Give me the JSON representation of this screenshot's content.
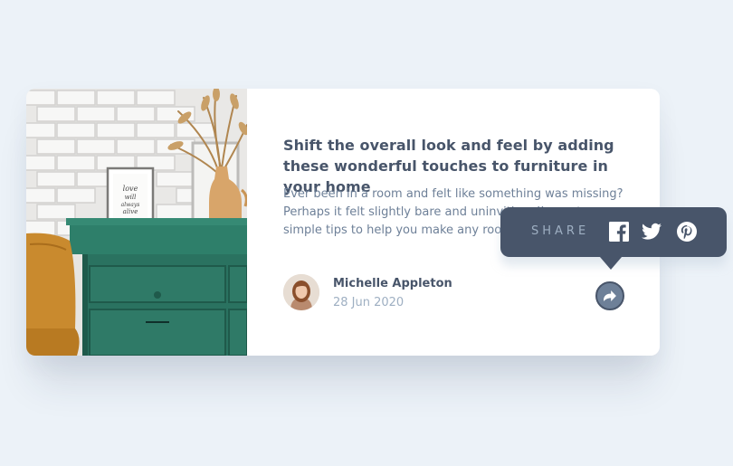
{
  "article": {
    "title": "Shift the overall look and feel by adding these wonderful touches to furniture in your home",
    "description": "Ever been in a room and felt like something was missing? Perhaps it felt slightly bare and uninviting. I’ve got some simple tips to help you make any room feel complete."
  },
  "author": {
    "name": "Michelle Appleton",
    "date": "28 Jun 2020"
  },
  "share": {
    "label": "SHARE",
    "networks": [
      "facebook-icon",
      "twitter-icon",
      "pinterest-icon"
    ],
    "button_icon": "share-arrow-icon"
  },
  "photo": {
    "frame_text": "love will always alive"
  },
  "colors": {
    "page_bg": "#ecf2f8",
    "card_bg": "#ffffff",
    "heading": "#48556a",
    "body": "#6e8098",
    "muted": "#9eafc2",
    "tooltip_bg": "#48556a",
    "dresser": "#2f7a67"
  }
}
